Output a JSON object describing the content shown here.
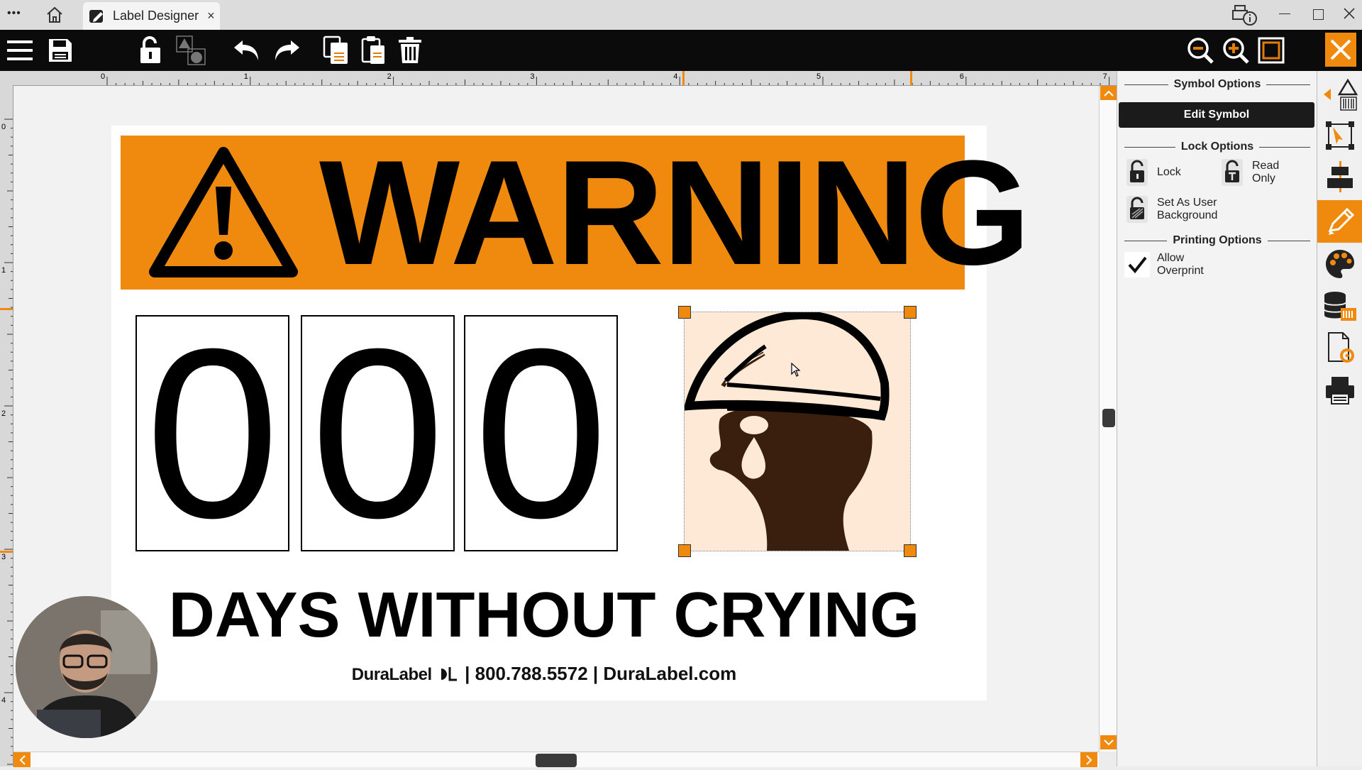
{
  "window": {
    "tab_title": "Label Designer",
    "tab_close": "×",
    "menu_dots": "•••"
  },
  "label": {
    "banner_text": "WARNING",
    "counter_digits": [
      "0",
      "0",
      "0"
    ],
    "main_text": "DAYS WITHOUT CRYING",
    "footer_brand": "DuraLabel",
    "footer_contact": "| 800.788.5572 | DuraLabel.com",
    "colors": {
      "banner": "#ef8a0e",
      "symbol_bg": "#fde9d6",
      "symbol_fg": "#3a1f0f"
    }
  },
  "ruler": {
    "h_numbers": [
      "0",
      "1",
      "2",
      "3",
      "4",
      "5",
      "6",
      "7"
    ],
    "v_numbers": [
      "0",
      "1",
      "2",
      "3",
      "4"
    ]
  },
  "panel": {
    "title": "Symbol Options",
    "edit_button": "Edit Symbol",
    "lock_section": "Lock Options",
    "lock": "Lock",
    "read_only": "Read\nOnly",
    "set_background": "Set As User\nBackground",
    "printing_section": "Printing Options",
    "allow_overprint": "Allow\nOverprint"
  },
  "icons": {
    "toolbar": [
      "menu-icon",
      "save-icon",
      "lock-icon",
      "arrange-icon",
      "undo-icon",
      "redo-icon",
      "copy-icon",
      "paste-icon",
      "delete-icon",
      "zoom-out-icon",
      "zoom-in-icon",
      "fit-icon",
      "close-icon"
    ],
    "sidebar": [
      "insert-symbol-icon",
      "transform-icon",
      "align-icon",
      "edit-pencil-icon",
      "palette-icon",
      "database-icon",
      "page-settings-icon",
      "print-icon"
    ]
  }
}
